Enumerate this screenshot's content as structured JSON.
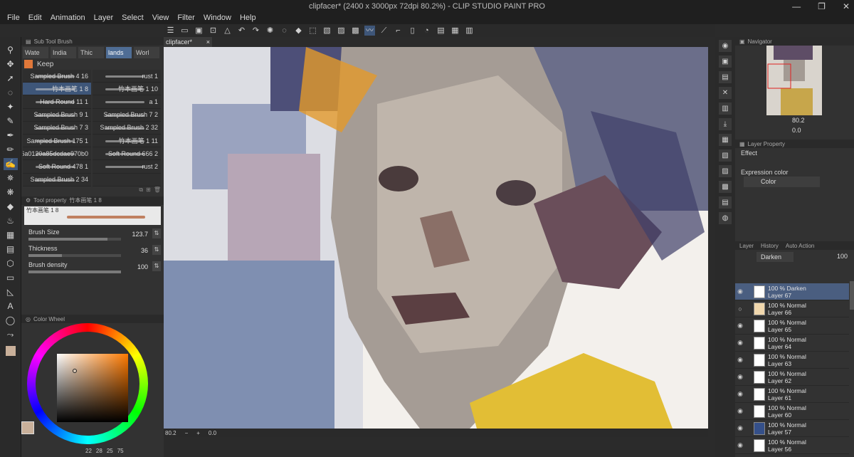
{
  "window": {
    "title": "clipfacer* (2400 x 3000px 72dpi 80.2%) - CLIP STUDIO PAINT PRO",
    "controls": [
      "—",
      "❐",
      "✕"
    ]
  },
  "menu": [
    "File",
    "Edit",
    "Animation",
    "Layer",
    "Select",
    "View",
    "Filter",
    "Window",
    "Help"
  ],
  "sub_tool": {
    "header": "Sub Tool Brush",
    "tabs": [
      "Wate",
      "India",
      "Thic",
      "lands",
      "Worl"
    ],
    "active_tab": 3,
    "keep_label": "Keep",
    "brushes": [
      [
        "Sampled Brush 4 16",
        "rust 1"
      ],
      [
        "竹本画笔 1 8",
        "竹本画笔 1 10"
      ],
      [
        "Hard Round 11 1",
        "a 1"
      ],
      [
        "Sampled Brush 9 1",
        "Sampled Brush 7 2"
      ],
      [
        "Sampled Brush 7 3",
        "Sampled Brush 2 32"
      ],
      [
        "Sampled Brush 175 1",
        "竹本画笔 1 11"
      ],
      [
        "6a0120a85dcdae970b0",
        "Soft Round 666 2"
      ],
      [
        "Soft Round 478 1",
        "rust 2"
      ],
      [
        "Sampled Brush 2 34",
        ""
      ]
    ]
  },
  "tool_property": {
    "header": "Tool property",
    "brush_name": "竹本画笔 1 8",
    "brush_size": {
      "label": "Brush Size",
      "value": "123.7",
      "fraction": 0.85
    },
    "thickness": {
      "label": "Thickness",
      "value": "36",
      "fraction": 0.36
    },
    "brush_density": {
      "label": "Brush density",
      "value": "100",
      "fraction": 1.0
    }
  },
  "color_wheel": {
    "header": "Color Wheel",
    "main_color": "#c9b09a",
    "readout": [
      "22",
      "28",
      "25",
      "75"
    ]
  },
  "canvas": {
    "tab_label": "clipfacer*",
    "zoom": "80.2",
    "angle": "0.0"
  },
  "navigator": {
    "header": "Navigator",
    "zoom": "80.2",
    "rotation": "0.0"
  },
  "layer_property": {
    "header": "Layer Property",
    "effect_label": "Effect",
    "expression_label": "Expression color",
    "expression_value": "Color"
  },
  "layers_panel": {
    "tabs": [
      "Layer",
      "History",
      "Auto Action"
    ],
    "blend_mode": "Darken",
    "opacity": "100",
    "layers": [
      {
        "mode": "100 % Darken",
        "name": "Layer 67"
      },
      {
        "mode": "100 % Normal",
        "name": "Layer 66"
      },
      {
        "mode": "100 % Normal",
        "name": "Layer 65"
      },
      {
        "mode": "100 % Normal",
        "name": "Layer 64"
      },
      {
        "mode": "100 % Normal",
        "name": "Layer 63"
      },
      {
        "mode": "100 % Normal",
        "name": "Layer 62"
      },
      {
        "mode": "100 % Normal",
        "name": "Layer 61"
      },
      {
        "mode": "100 % Normal",
        "name": "Layer 60"
      },
      {
        "mode": "100 % Normal",
        "name": "Layer 57"
      },
      {
        "mode": "100 % Normal",
        "name": "Layer 56"
      }
    ],
    "active_layer": 0
  },
  "colors": {
    "accent": "#3e5679",
    "panel": "#323232",
    "dark": "#2a2a2a"
  }
}
